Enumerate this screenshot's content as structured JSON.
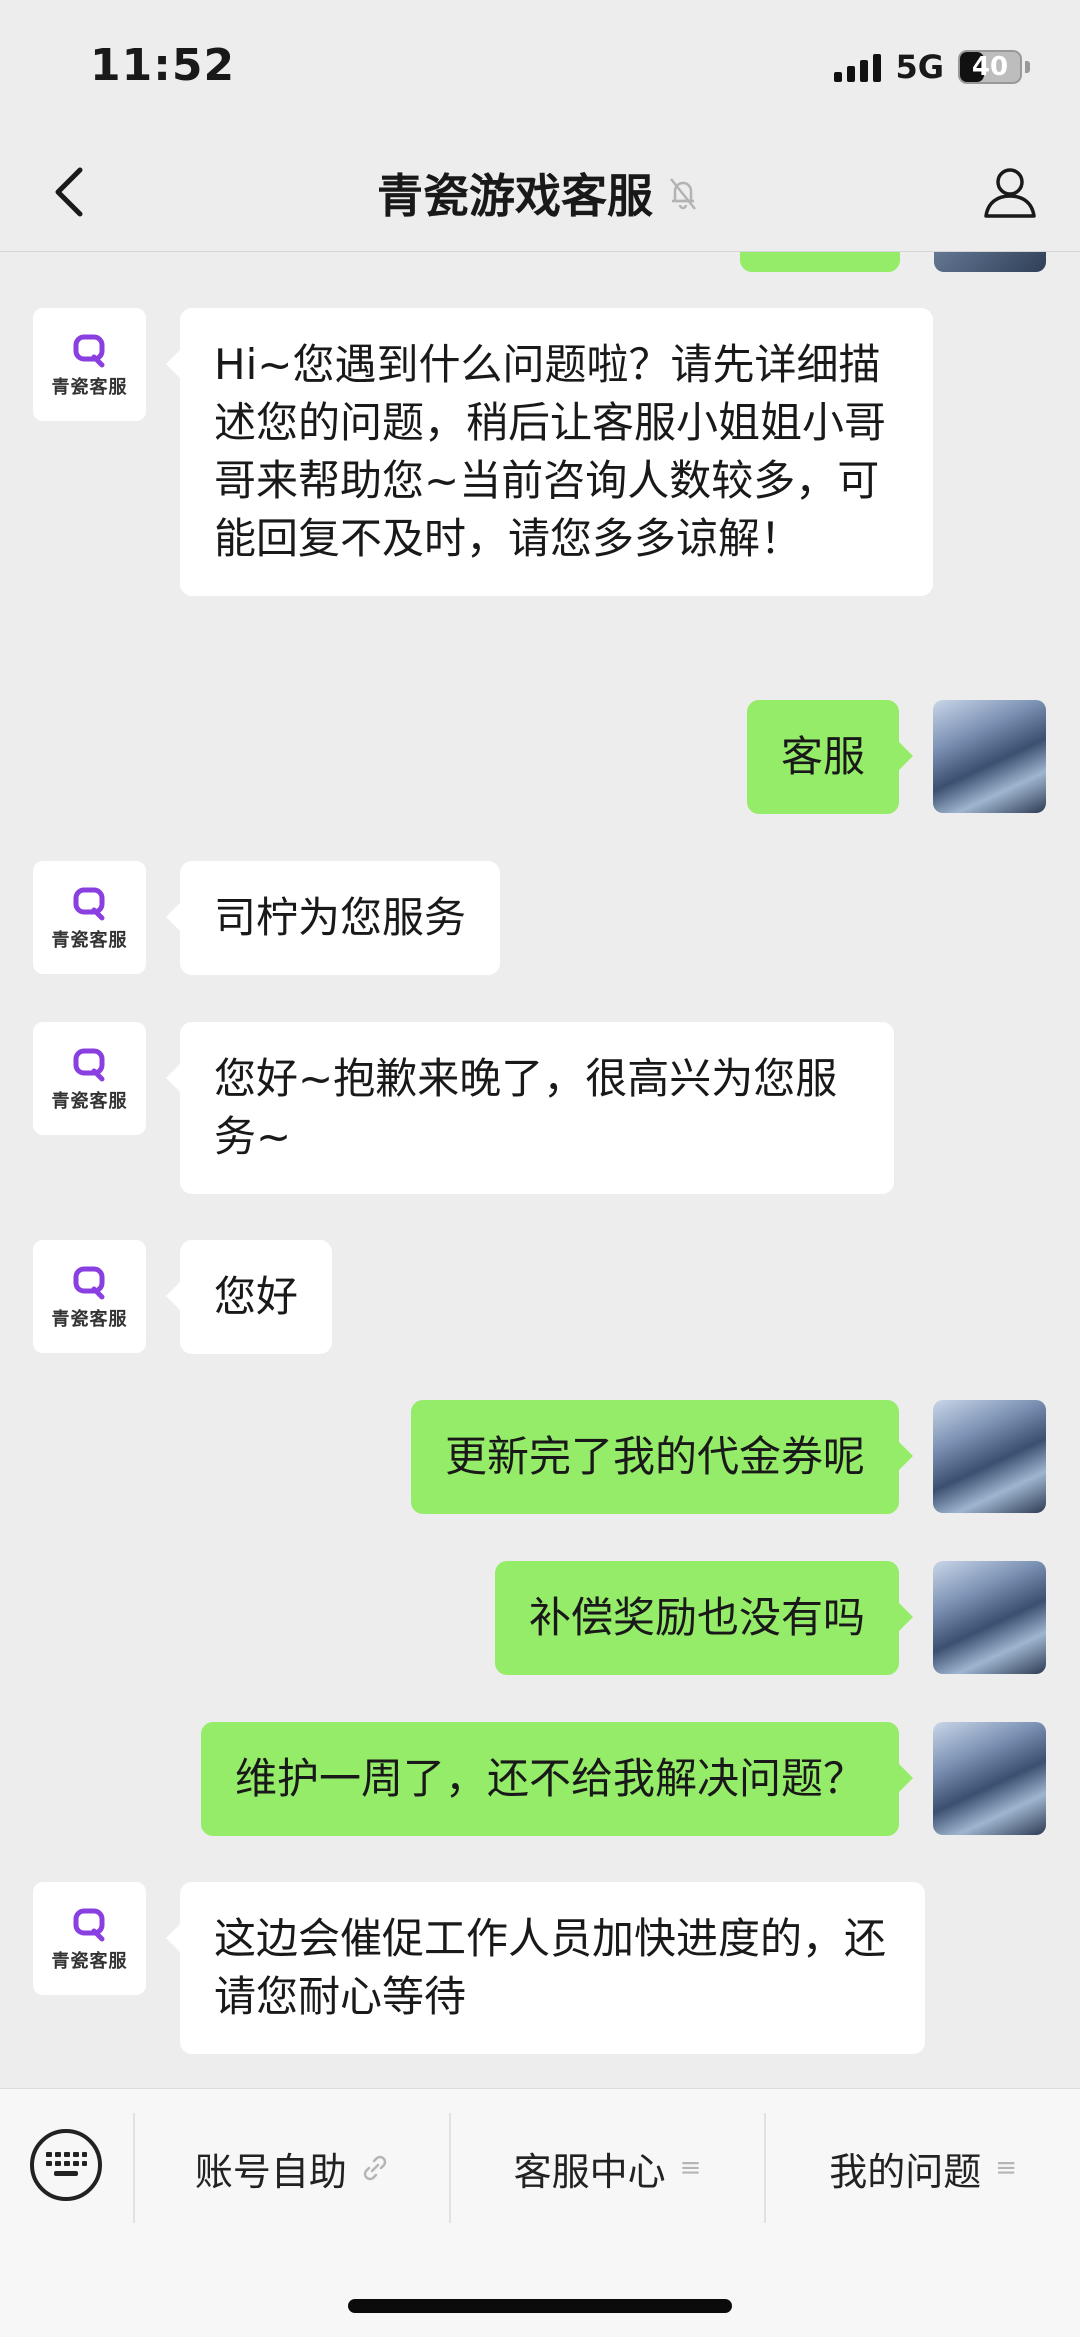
{
  "status_bar": {
    "time": "11:52",
    "network": "5G",
    "battery": "40",
    "battery_level": 0.4
  },
  "nav": {
    "title": "青瓷游戏客服",
    "back_icon": "chevron-left-icon",
    "mute_icon": "bell-off-icon",
    "profile_icon": "person-icon"
  },
  "service_avatar": {
    "logo_text": "青瓷客服",
    "brand_color": "#8a3fe0"
  },
  "messages": [
    {
      "side": "left",
      "text": "Hi~您遇到什么问题啦？请先详细描述您的问题，稍后让客服小姐姐小哥哥来帮助您~当前咨询人数较多，可能回复不及时，请您多多谅解！"
    },
    {
      "side": "right",
      "text": "客服"
    },
    {
      "side": "left",
      "text": "司柠为您服务"
    },
    {
      "side": "left",
      "text": "您好~抱歉来晚了，很高兴为您服务~"
    },
    {
      "side": "left",
      "text": "您好"
    },
    {
      "side": "right",
      "text": "更新完了我的代金券呢"
    },
    {
      "side": "right",
      "text": "补偿奖励也没有吗"
    },
    {
      "side": "right",
      "text": "维护一周了，还不给我解决问题？"
    },
    {
      "side": "left",
      "text": "这边会催促工作人员加快进度的，还请您耐心等待"
    }
  ],
  "bottom_menu": {
    "keyboard_icon": "keyboard-icon",
    "items": [
      {
        "label": "账号自助",
        "icon": "link-icon"
      },
      {
        "label": "客服中心",
        "icon": "menu-lines-icon"
      },
      {
        "label": "我的问题",
        "icon": "menu-lines-icon"
      }
    ]
  },
  "colors": {
    "background": "#ededed",
    "bubble_self": "#95ec69",
    "bubble_other": "#ffffff"
  }
}
